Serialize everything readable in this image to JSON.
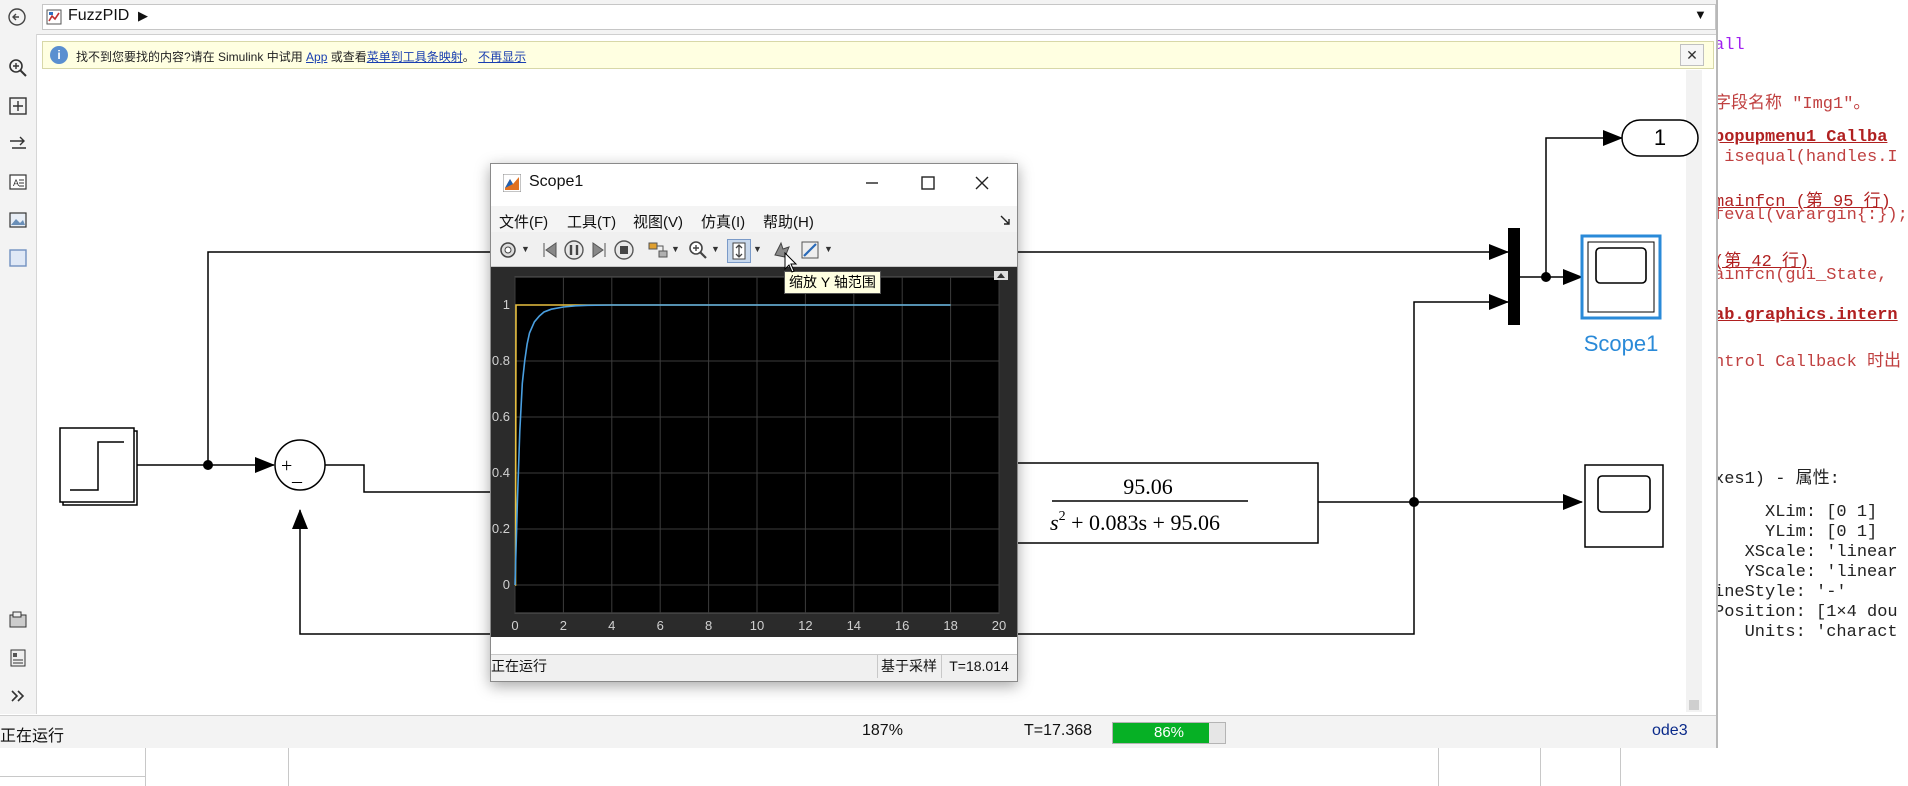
{
  "simulink": {
    "model_name": "FuzzPID",
    "info_bar": {
      "text_before_app": "找不到您要找的内容?请在 Simulink 中试用 ",
      "app_link": "App",
      "text_middle": " 或查看",
      "tool_link": "菜单到工具条映射",
      "separator": "。",
      "dismiss_link": "不再显示"
    },
    "left_toolbar_icons": [
      "zoom-icon",
      "fit-view-icon",
      "arrow-direction-icon",
      "annotation-icon",
      "image-icon",
      "area-icon",
      "model-browser-icon",
      "property-inspector-icon",
      "expand-icon"
    ],
    "diagram": {
      "transfer_fcn": {
        "numerator": "95.06",
        "denominator_s": "s",
        "denominator_exp": "2",
        "denominator_rest": " + 0.083s + 95.06"
      },
      "sum_signs": {
        "plus": "+",
        "minus": "–"
      },
      "scope1_label": "Scope1",
      "outport_label": "1"
    },
    "status_bar": {
      "state": "正在运行",
      "zoom": "187%",
      "time": "T=17.368",
      "progress_text": "86%",
      "progress_value": 0.86,
      "solver": "ode3"
    }
  },
  "scope": {
    "title": "Scope1",
    "menu": [
      "文件(F)",
      "工具(T)",
      "视图(V)",
      "仿真(I)",
      "帮助(H)"
    ],
    "tooltip": "缩放 Y 轴范围",
    "status_left": "正在运行",
    "status_mode": "基于采样",
    "status_time": "T=18.014"
  },
  "chart_data": {
    "type": "line",
    "xlim": [
      0,
      20
    ],
    "ylim": [
      -0.1,
      1.1
    ],
    "xticks": [
      0,
      2,
      4,
      6,
      8,
      10,
      12,
      14,
      16,
      18,
      20
    ],
    "yticks": [
      0,
      0.2,
      0.4,
      0.6,
      0.8,
      1
    ],
    "grid": true,
    "background": "#000000",
    "series": [
      {
        "color": "#e8c040",
        "x": [
          0,
          0.02,
          0.04,
          18
        ],
        "y": [
          0,
          0,
          1,
          1
        ]
      },
      {
        "color": "#4a9fe0",
        "x": [
          0,
          0.1,
          0.2,
          0.3,
          0.4,
          0.5,
          0.6,
          0.8,
          1.0,
          1.2,
          1.5,
          2.0,
          2.5,
          3.0,
          4.0,
          18
        ],
        "y": [
          0,
          0.3,
          0.55,
          0.72,
          0.8,
          0.86,
          0.9,
          0.94,
          0.96,
          0.975,
          0.985,
          0.993,
          0.997,
          0.999,
          1.0,
          1.0
        ]
      }
    ]
  },
  "editor": {
    "lines": [
      {
        "text": "all",
        "cls": "c-purple"
      },
      {
        "text": "字段名称 \"Img1\"。",
        "cls": "c-red"
      },
      {
        "text": "popupmenu1_Callba",
        "cls": "c-link"
      },
      {
        "text": " isequal(handles.I",
        "cls": "c-red"
      },
      {
        "text": "mainfcn (第 95 行)",
        "cls": "c-link2"
      },
      {
        "text": "feval(varargin{:});",
        "cls": "c-red"
      },
      {
        "text": "(第 42 行)",
        "cls": "c-link2"
      },
      {
        "text": "ainfcn(gui_State,",
        "cls": "c-red"
      },
      {
        "text": "ab.graphics.intern",
        "cls": "c-link"
      },
      {
        "text": "ntrol Callback 时出",
        "cls": "c-red"
      },
      {
        "text": "xes1) - 属性:",
        "cls": ""
      },
      {
        "text": "     XLim: [0 1]",
        "cls": ""
      },
      {
        "text": "     YLim: [0 1]",
        "cls": ""
      },
      {
        "text": "   XScale: 'linear",
        "cls": ""
      },
      {
        "text": "   YScale: 'linear",
        "cls": ""
      },
      {
        "text": "ineStyle: '-'",
        "cls": ""
      },
      {
        "text": "Position: [1×4 dou",
        "cls": ""
      },
      {
        "text": "   Units: 'charact",
        "cls": ""
      }
    ]
  }
}
